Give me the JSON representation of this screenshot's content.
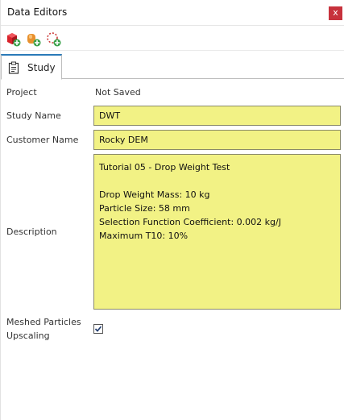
{
  "window": {
    "title": "Data Editors",
    "close_label": "x"
  },
  "toolbar": {
    "buttons": [
      {
        "icon": "add-red-cube-icon"
      },
      {
        "icon": "add-orange-shape-icon"
      },
      {
        "icon": "add-dotted-selection-icon"
      }
    ]
  },
  "tab": {
    "label": "Study",
    "icon": "clipboard-icon"
  },
  "form": {
    "project_label": "Project",
    "project_value": "Not Saved",
    "study_name_label": "Study Name",
    "study_name_value": "DWT",
    "customer_name_label": "Customer Name",
    "customer_name_value": "Rocky DEM",
    "description_label": "Description",
    "description_lines": [
      "Tutorial 05 - Drop Weight Test",
      "",
      "Drop Weight Mass: 10 kg",
      "Particle Size: 58 mm",
      "Selection Function Coefficient: 0.002 kg/J",
      "Maximum T10: 10%"
    ],
    "upscaling_label_line1": "Meshed Particles",
    "upscaling_label_line2": "Upscaling",
    "upscaling_checked": true
  },
  "colors": {
    "field_background": "#f2f285",
    "close_button": "#c7323c",
    "tab_accent": "#2a7ab8"
  }
}
